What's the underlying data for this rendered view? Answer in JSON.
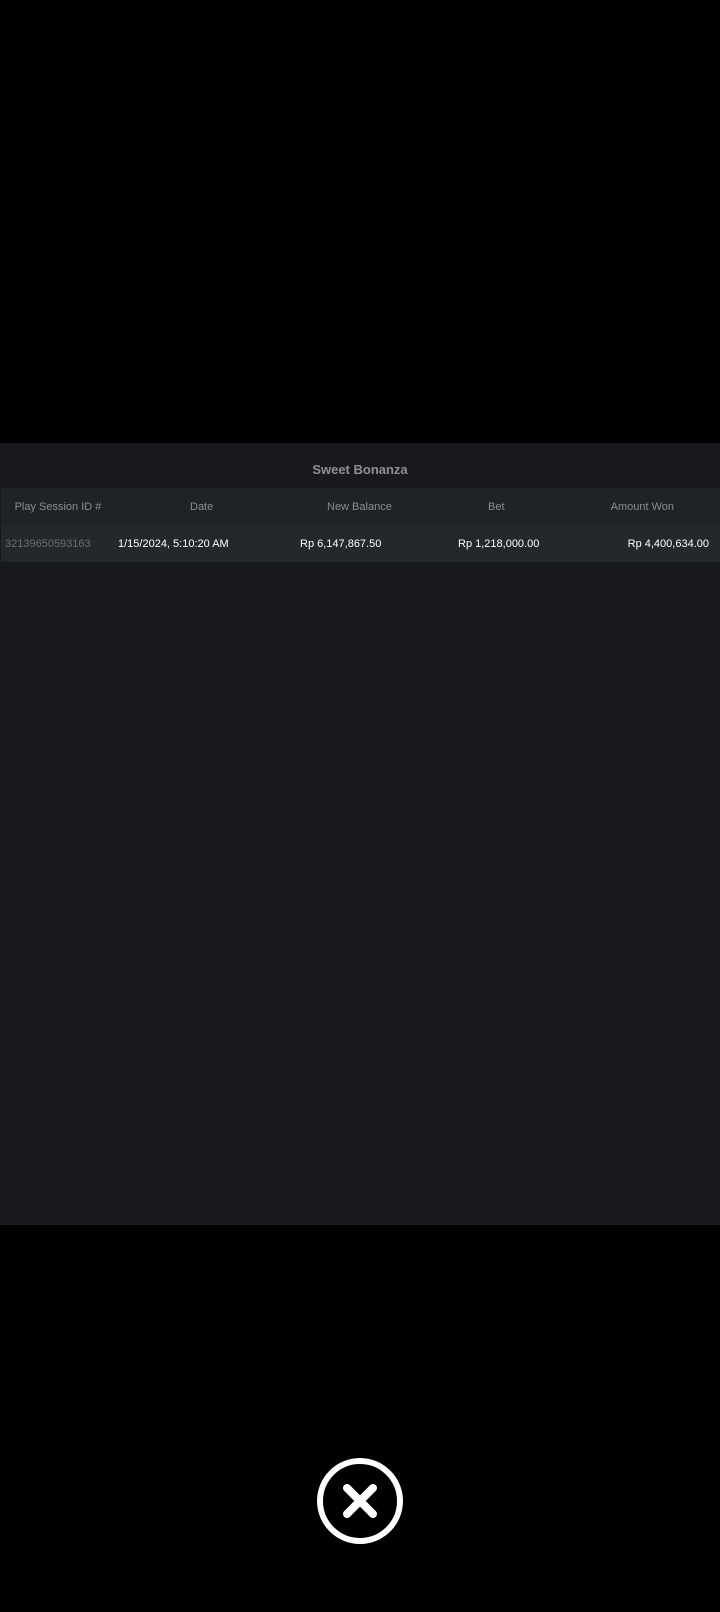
{
  "game_history": {
    "title": "Sweet Bonanza",
    "columns": {
      "session_id": "Play Session ID #",
      "date": "Date",
      "new_balance": "New Balance",
      "bet": "Bet",
      "amount_won": "Amount Won"
    },
    "rows": [
      {
        "session_id": "32139650593163",
        "date": "1/15/2024, 5:10:20 AM",
        "new_balance": "Rp 6,147,867.50",
        "bet": "Rp 1,218,000.00",
        "amount_won": "Rp 4,400,634.00"
      }
    ]
  },
  "close_control": {
    "icon": "close-icon"
  },
  "colors": {
    "background": "#000000",
    "panel": "#18191c",
    "header_row": "#1f2326",
    "data_row": "#23282b",
    "muted_text": "#8a8d91",
    "value_text": "#ffffff"
  }
}
